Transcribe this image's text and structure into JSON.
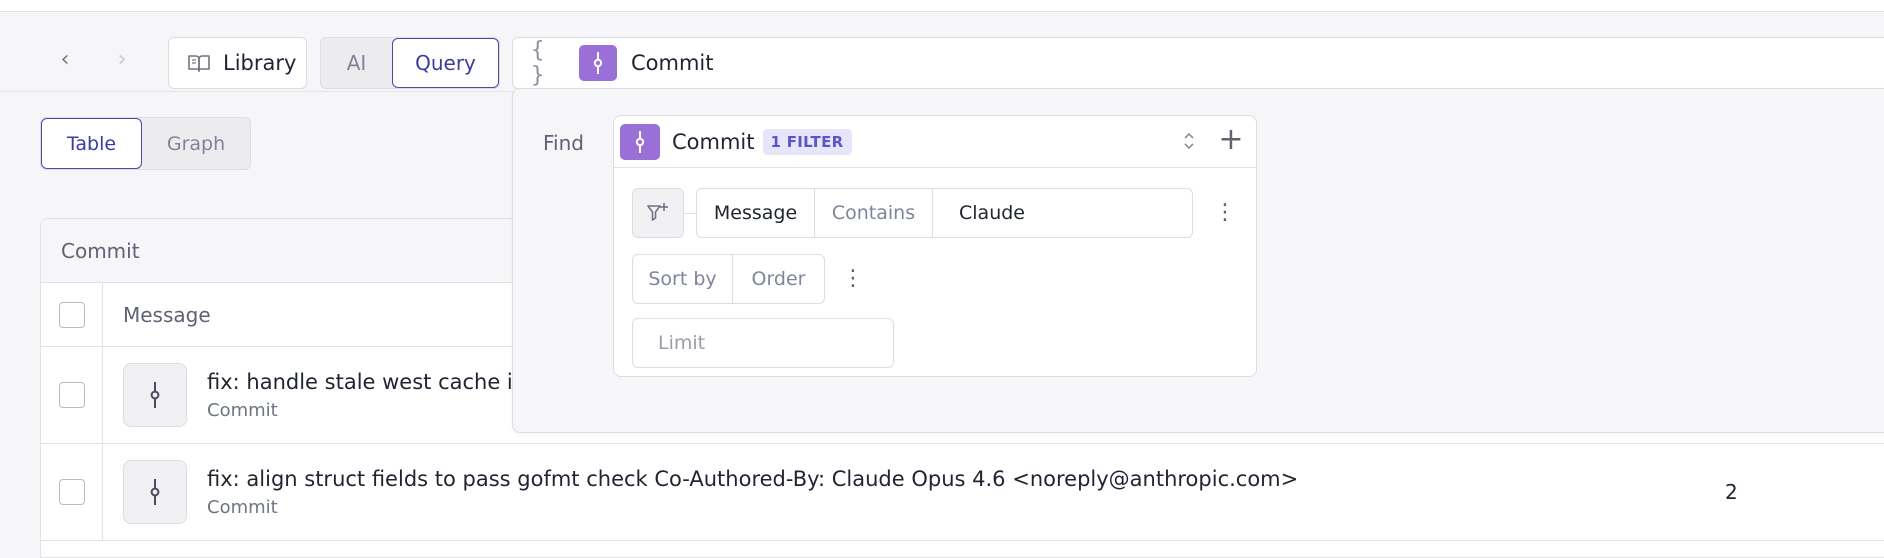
{
  "toolbar": {
    "back_glyph": "‹",
    "forward_glyph": "›",
    "library_label": "Library",
    "mode_tabs": [
      {
        "label": "AI",
        "active": false
      },
      {
        "label": "Query",
        "active": true
      }
    ],
    "braces_glyph": "{ }",
    "search_entity": "Commit"
  },
  "view_tabs": [
    {
      "label": "Table",
      "active": true
    },
    {
      "label": "Graph",
      "active": false
    }
  ],
  "table": {
    "title": "Commit",
    "column_header": "Message",
    "rows": [
      {
        "title": "fix: handle stale west cache in",
        "subtitle": "Commit",
        "value": ""
      },
      {
        "title": "fix: align struct fields to pass gofmt check Co-Authored-By: Claude Opus 4.6 <noreply@anthropic.com>",
        "subtitle": "Commit",
        "value": "2"
      }
    ]
  },
  "query_popover": {
    "find_label": "Find",
    "entity": "Commit",
    "filter_badge": "1 FILTER",
    "filter": {
      "field": "Message",
      "operator": "Contains",
      "value": "Claude"
    },
    "sort_by_label": "Sort by",
    "order_label": "Order",
    "limit_placeholder": "Limit",
    "plus_glyph": "+",
    "more_glyph": "⋮"
  },
  "colors": {
    "accent": "#4b48a8",
    "commit_icon_bg": "#9a6fd8",
    "badge_bg": "#e6e5fa",
    "badge_text": "#5a55c8"
  },
  "icons": {
    "library": "book-icon",
    "commit": "git-commit-icon",
    "filter_add": "filter-plus-icon"
  }
}
